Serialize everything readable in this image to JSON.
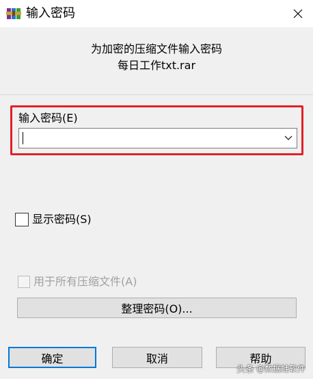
{
  "window": {
    "title": "输入密码",
    "icon": "winrar-icon"
  },
  "heading": {
    "line1": "为加密的压缩文件输入密码",
    "line2": "每日工作txt.rar"
  },
  "password": {
    "label": "输入密码(E)",
    "value": "",
    "highlight_color": "#e0202a"
  },
  "show_password": {
    "label": "显示密码(S)",
    "checked": false
  },
  "use_for_all": {
    "label": "用于所有压缩文件(A)",
    "checked": false,
    "enabled": false
  },
  "organize_button": {
    "label": "整理密码(O)..."
  },
  "buttons": {
    "ok": "确定",
    "cancel": "取消",
    "help": "帮助"
  },
  "watermark": {
    "prefix": "头条",
    "handle": "@数据蛙软件"
  },
  "colors": {
    "accent": "#0078d7",
    "background": "#f0f0f0"
  }
}
